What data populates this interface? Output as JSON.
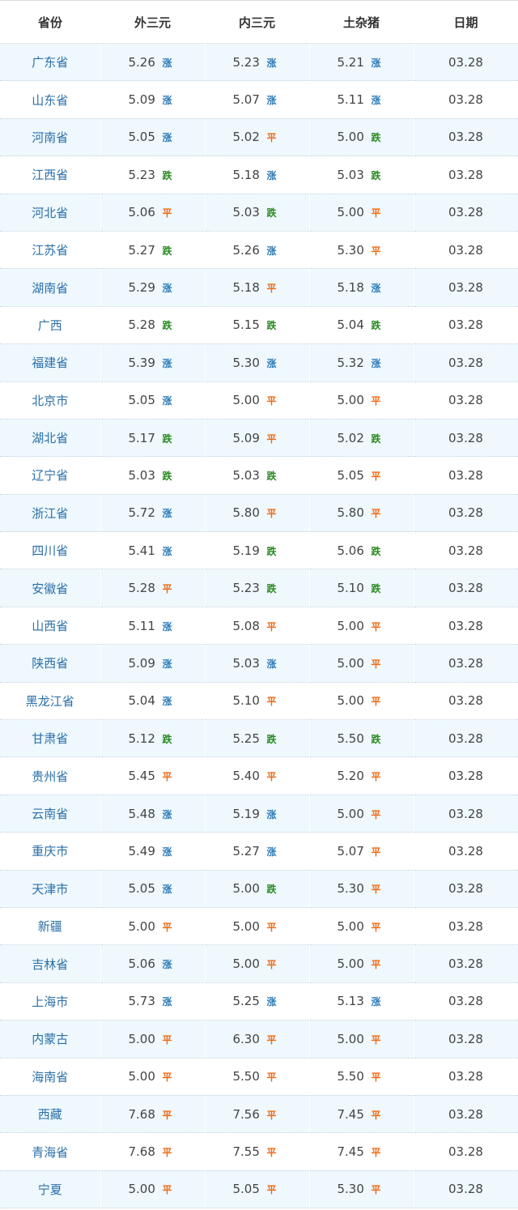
{
  "headers": {
    "province": "省份",
    "outer": "外三元",
    "inner": "内三元",
    "local": "土杂猪",
    "date": "日期"
  },
  "colors": {
    "rise": "#2d7bb8",
    "fall": "#2a8a22",
    "flat": "#ee6a13",
    "row_alt": "#eef8fd",
    "province_text": "#2b6fa8"
  },
  "rows": [
    {
      "province": "广东省",
      "outer": {
        "value": "5.26",
        "trend": "涨"
      },
      "inner": {
        "value": "5.23",
        "trend": "涨"
      },
      "local": {
        "value": "5.21",
        "trend": "涨"
      },
      "date": "03.28"
    },
    {
      "province": "山东省",
      "outer": {
        "value": "5.09",
        "trend": "涨"
      },
      "inner": {
        "value": "5.07",
        "trend": "涨"
      },
      "local": {
        "value": "5.11",
        "trend": "涨"
      },
      "date": "03.28"
    },
    {
      "province": "河南省",
      "outer": {
        "value": "5.05",
        "trend": "涨"
      },
      "inner": {
        "value": "5.02",
        "trend": "平"
      },
      "local": {
        "value": "5.00",
        "trend": "跌"
      },
      "date": "03.28"
    },
    {
      "province": "江西省",
      "outer": {
        "value": "5.23",
        "trend": "跌"
      },
      "inner": {
        "value": "5.18",
        "trend": "涨"
      },
      "local": {
        "value": "5.03",
        "trend": "跌"
      },
      "date": "03.28"
    },
    {
      "province": "河北省",
      "outer": {
        "value": "5.06",
        "trend": "平"
      },
      "inner": {
        "value": "5.03",
        "trend": "跌"
      },
      "local": {
        "value": "5.00",
        "trend": "平"
      },
      "date": "03.28"
    },
    {
      "province": "江苏省",
      "outer": {
        "value": "5.27",
        "trend": "跌"
      },
      "inner": {
        "value": "5.26",
        "trend": "涨"
      },
      "local": {
        "value": "5.30",
        "trend": "平"
      },
      "date": "03.28"
    },
    {
      "province": "湖南省",
      "outer": {
        "value": "5.29",
        "trend": "涨"
      },
      "inner": {
        "value": "5.18",
        "trend": "平"
      },
      "local": {
        "value": "5.18",
        "trend": "涨"
      },
      "date": "03.28"
    },
    {
      "province": "广西",
      "outer": {
        "value": "5.28",
        "trend": "跌"
      },
      "inner": {
        "value": "5.15",
        "trend": "跌"
      },
      "local": {
        "value": "5.04",
        "trend": "跌"
      },
      "date": "03.28"
    },
    {
      "province": "福建省",
      "outer": {
        "value": "5.39",
        "trend": "涨"
      },
      "inner": {
        "value": "5.30",
        "trend": "涨"
      },
      "local": {
        "value": "5.32",
        "trend": "涨"
      },
      "date": "03.28"
    },
    {
      "province": "北京市",
      "outer": {
        "value": "5.05",
        "trend": "涨"
      },
      "inner": {
        "value": "5.00",
        "trend": "平"
      },
      "local": {
        "value": "5.00",
        "trend": "平"
      },
      "date": "03.28"
    },
    {
      "province": "湖北省",
      "outer": {
        "value": "5.17",
        "trend": "跌"
      },
      "inner": {
        "value": "5.09",
        "trend": "平"
      },
      "local": {
        "value": "5.02",
        "trend": "跌"
      },
      "date": "03.28"
    },
    {
      "province": "辽宁省",
      "outer": {
        "value": "5.03",
        "trend": "跌"
      },
      "inner": {
        "value": "5.03",
        "trend": "跌"
      },
      "local": {
        "value": "5.05",
        "trend": "平"
      },
      "date": "03.28"
    },
    {
      "province": "浙江省",
      "outer": {
        "value": "5.72",
        "trend": "涨"
      },
      "inner": {
        "value": "5.80",
        "trend": "平"
      },
      "local": {
        "value": "5.80",
        "trend": "平"
      },
      "date": "03.28"
    },
    {
      "province": "四川省",
      "outer": {
        "value": "5.41",
        "trend": "涨"
      },
      "inner": {
        "value": "5.19",
        "trend": "跌"
      },
      "local": {
        "value": "5.06",
        "trend": "跌"
      },
      "date": "03.28"
    },
    {
      "province": "安徽省",
      "outer": {
        "value": "5.28",
        "trend": "平"
      },
      "inner": {
        "value": "5.23",
        "trend": "跌"
      },
      "local": {
        "value": "5.10",
        "trend": "跌"
      },
      "date": "03.28"
    },
    {
      "province": "山西省",
      "outer": {
        "value": "5.11",
        "trend": "涨"
      },
      "inner": {
        "value": "5.08",
        "trend": "平"
      },
      "local": {
        "value": "5.00",
        "trend": "平"
      },
      "date": "03.28"
    },
    {
      "province": "陕西省",
      "outer": {
        "value": "5.09",
        "trend": "涨"
      },
      "inner": {
        "value": "5.03",
        "trend": "涨"
      },
      "local": {
        "value": "5.00",
        "trend": "平"
      },
      "date": "03.28"
    },
    {
      "province": "黑龙江省",
      "outer": {
        "value": "5.04",
        "trend": "涨"
      },
      "inner": {
        "value": "5.10",
        "trend": "平"
      },
      "local": {
        "value": "5.00",
        "trend": "平"
      },
      "date": "03.28"
    },
    {
      "province": "甘肃省",
      "outer": {
        "value": "5.12",
        "trend": "跌"
      },
      "inner": {
        "value": "5.25",
        "trend": "跌"
      },
      "local": {
        "value": "5.50",
        "trend": "跌"
      },
      "date": "03.28"
    },
    {
      "province": "贵州省",
      "outer": {
        "value": "5.45",
        "trend": "平"
      },
      "inner": {
        "value": "5.40",
        "trend": "平"
      },
      "local": {
        "value": "5.20",
        "trend": "平"
      },
      "date": "03.28"
    },
    {
      "province": "云南省",
      "outer": {
        "value": "5.48",
        "trend": "涨"
      },
      "inner": {
        "value": "5.19",
        "trend": "涨"
      },
      "local": {
        "value": "5.00",
        "trend": "平"
      },
      "date": "03.28"
    },
    {
      "province": "重庆市",
      "outer": {
        "value": "5.49",
        "trend": "涨"
      },
      "inner": {
        "value": "5.27",
        "trend": "涨"
      },
      "local": {
        "value": "5.07",
        "trend": "平"
      },
      "date": "03.28"
    },
    {
      "province": "天津市",
      "outer": {
        "value": "5.05",
        "trend": "涨"
      },
      "inner": {
        "value": "5.00",
        "trend": "跌"
      },
      "local": {
        "value": "5.30",
        "trend": "平"
      },
      "date": "03.28"
    },
    {
      "province": "新疆",
      "outer": {
        "value": "5.00",
        "trend": "平"
      },
      "inner": {
        "value": "5.00",
        "trend": "平"
      },
      "local": {
        "value": "5.00",
        "trend": "平"
      },
      "date": "03.28"
    },
    {
      "province": "吉林省",
      "outer": {
        "value": "5.06",
        "trend": "涨"
      },
      "inner": {
        "value": "5.00",
        "trend": "平"
      },
      "local": {
        "value": "5.00",
        "trend": "平"
      },
      "date": "03.28"
    },
    {
      "province": "上海市",
      "outer": {
        "value": "5.73",
        "trend": "涨"
      },
      "inner": {
        "value": "5.25",
        "trend": "涨"
      },
      "local": {
        "value": "5.13",
        "trend": "涨"
      },
      "date": "03.28"
    },
    {
      "province": "内蒙古",
      "outer": {
        "value": "5.00",
        "trend": "平"
      },
      "inner": {
        "value": "6.30",
        "trend": "平"
      },
      "local": {
        "value": "5.00",
        "trend": "平"
      },
      "date": "03.28"
    },
    {
      "province": "海南省",
      "outer": {
        "value": "5.00",
        "trend": "平"
      },
      "inner": {
        "value": "5.50",
        "trend": "平"
      },
      "local": {
        "value": "5.50",
        "trend": "平"
      },
      "date": "03.28"
    },
    {
      "province": "西藏",
      "outer": {
        "value": "7.68",
        "trend": "平"
      },
      "inner": {
        "value": "7.56",
        "trend": "平"
      },
      "local": {
        "value": "7.45",
        "trend": "平"
      },
      "date": "03.28"
    },
    {
      "province": "青海省",
      "outer": {
        "value": "7.68",
        "trend": "平"
      },
      "inner": {
        "value": "7.55",
        "trend": "平"
      },
      "local": {
        "value": "7.45",
        "trend": "平"
      },
      "date": "03.28"
    },
    {
      "province": "宁夏",
      "outer": {
        "value": "5.00",
        "trend": "平"
      },
      "inner": {
        "value": "5.05",
        "trend": "平"
      },
      "local": {
        "value": "5.30",
        "trend": "平"
      },
      "date": "03.28"
    }
  ]
}
